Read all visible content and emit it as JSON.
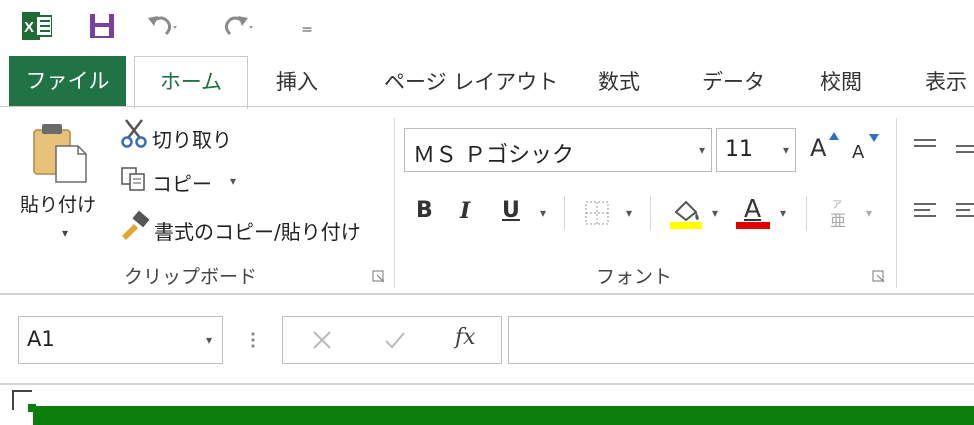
{
  "qat": {
    "icons": [
      "excel-logo-icon",
      "save-icon",
      "undo-icon",
      "redo-icon",
      "customize-qat-icon"
    ],
    "dropdown_glyph": "▾",
    "more_glyph": "="
  },
  "tabs": [
    {
      "label": "ファイル",
      "state": "file"
    },
    {
      "label": "ホーム",
      "state": "active"
    },
    {
      "label": "挿入"
    },
    {
      "label": "ページ レイアウト"
    },
    {
      "label": "数式"
    },
    {
      "label": "データ"
    },
    {
      "label": "校閲"
    },
    {
      "label": "表示"
    }
  ],
  "clipboard": {
    "paste_label": "貼り付け",
    "cut_label": "切り取り",
    "copy_label": "コピー",
    "format_painter_label": "書式のコピー/貼り付け",
    "group_label": "クリップボード"
  },
  "font": {
    "font_name": "ＭＳ Ｐゴシック",
    "font_size": "11",
    "bold": "B",
    "italic": "I",
    "underline": "U",
    "font_color_letter": "A",
    "grow_letter": "A",
    "shrink_letter": "A",
    "group_label": "フォント",
    "highlight_color": "#ffff00",
    "font_color": "#e00000"
  },
  "formula_bar": {
    "name_box": "A1",
    "fx": "fx",
    "formula": ""
  },
  "colors": {
    "accent": "#217346",
    "sheet_strip": "#0b7d0b"
  }
}
